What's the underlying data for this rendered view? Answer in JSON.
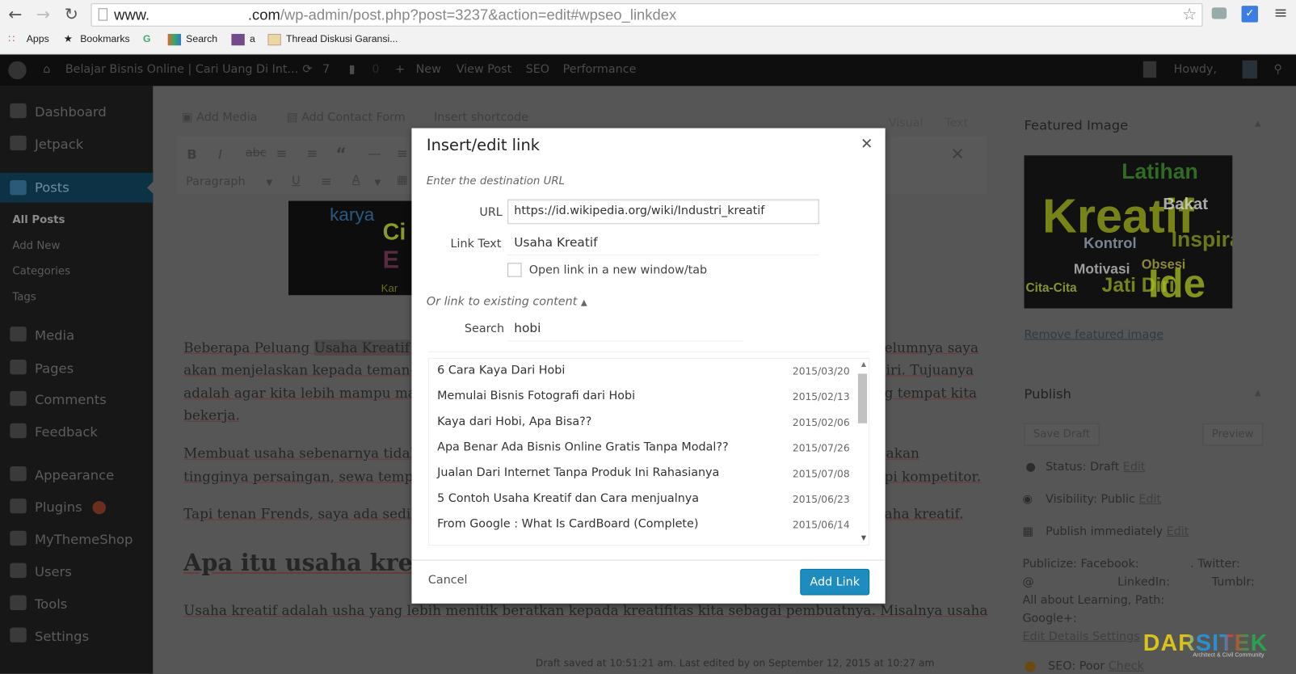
{
  "browser": {
    "url_prefix": "www.",
    "url_domain_suffix": ".com",
    "url_path": "/wp-admin/post.php?post=3237&action=edit#wpseo_linkdex",
    "bookmarks": [
      "Apps",
      "Bookmarks",
      "G",
      "Search",
      "a",
      "Thread Diskusi Garansi..."
    ]
  },
  "admin_bar": {
    "site_name": "Belajar Bisnis Online | Cari Uang Di Int...",
    "updates_count": "7",
    "comments_count": "0",
    "new_label": "New",
    "view_post": "View Post",
    "seo": "SEO",
    "performance": "Performance",
    "howdy": "Howdy,"
  },
  "sidebar": {
    "items": [
      {
        "label": "Dashboard",
        "icon": "dashboard-icon"
      },
      {
        "label": "Jetpack",
        "icon": "jetpack-icon"
      },
      {
        "label": "Posts",
        "icon": "pin-icon",
        "active": true
      },
      {
        "label": "All Posts",
        "sub": true,
        "current": true
      },
      {
        "label": "Add New",
        "sub": true
      },
      {
        "label": "Categories",
        "sub": true
      },
      {
        "label": "Tags",
        "sub": true
      },
      {
        "label": "Media",
        "icon": "media-icon"
      },
      {
        "label": "Pages",
        "icon": "pages-icon"
      },
      {
        "label": "Comments",
        "icon": "comments-icon"
      },
      {
        "label": "Feedback",
        "icon": "feedback-icon"
      },
      {
        "label": "Appearance",
        "icon": "appearance-icon"
      },
      {
        "label": "Plugins",
        "icon": "plugins-icon",
        "badge": true
      },
      {
        "label": "MyThemeShop",
        "icon": "mythemeshop-icon"
      },
      {
        "label": "Users",
        "icon": "users-icon"
      },
      {
        "label": "Tools",
        "icon": "tools-icon"
      },
      {
        "label": "Settings",
        "icon": "settings-icon"
      }
    ]
  },
  "editor": {
    "add_media": "Add Media",
    "add_contact_form": "Add Contact Form",
    "insert_shortcode": "Insert shortcode",
    "tab_visual": "Visual",
    "tab_text": "Text",
    "format_select": "Paragraph",
    "thumb_words": [
      "karya",
      "Ci",
      "E",
      "Kar"
    ],
    "lines": [
      {
        "left_pre": "Beberapa Peluang ",
        "left_hl": "Usaha Kreatif",
        "left_post": " U",
        "right": "elumnya saya"
      },
      {
        "left": "akan menjelaskan kepada teman-",
        "right": "iri. Tujuanya"
      },
      {
        "left": "adalah agar kita lebih mampu ma",
        "right": "g tempat kita"
      },
      {
        "left": "bekerja."
      },
      {
        "left": "Membuat usaha sebenarnya tidak",
        "right": "akan"
      },
      {
        "left": "tingginya persaingan, sewa tempa",
        "right": "pi kompetitor."
      },
      {
        "left": "Tapi tenan Frends, saya ada sedik",
        "right": "aha kreatif."
      }
    ],
    "heading": "Apa itu usaha kreat",
    "last_line": "Usaha kreatif adalah usha yang lebih menitik beratkan kepada kreatifitas kita sebagai pembuatnya. Misalnya usaha",
    "status": "Draft saved at 10:51:21 am. Last edited by      on September 12, 2015 at 10:27 am"
  },
  "featured_image": {
    "title": "Featured Image",
    "words": [
      "Latihan",
      "Kreatif",
      "Bakat",
      "Inspiras",
      "Kontrol",
      "Motivasi",
      "Cita-Cita",
      "Jati Diri",
      "Ide",
      "Obsesi"
    ],
    "remove_link": "Remove featured image"
  },
  "publish": {
    "title": "Publish",
    "save_draft": "Save Draft",
    "preview": "Preview",
    "status": "Status: Draft",
    "visibility": "Visibility: Public",
    "schedule": "Publish immediately",
    "edit": "Edit",
    "publicize_1": "Publicize: Facebook:",
    "publicize_twitter": ". Twitter:",
    "publicize_2a": "@",
    "publicize_linkedin": "LinkedIn:",
    "publicize_tumblr": "Tumblr:",
    "publicize_3": "All about Learning, Path:",
    "publicize_4": "Google+:",
    "edit_details": "Edit Details Settings",
    "seo_label": "SEO: Poor",
    "seo_check": "Check"
  },
  "watermark": {
    "text": "DARSITEK",
    "tagline": "Architect & Civil Community"
  },
  "modal": {
    "title": "Insert/edit link",
    "subtitle": "Enter the destination URL",
    "url_label": "URL",
    "url_value": "https://id.wikipedia.org/wiki/Industri_kreatif",
    "link_text_label": "Link Text",
    "link_text_value": "Usaha Kreatif",
    "new_tab_label": "Open link in a new window/tab",
    "new_tab_checked": false,
    "existing_toggle": "Or link to existing content",
    "search_label": "Search",
    "search_value": "hobi",
    "results": [
      {
        "title": "6 Cara Kaya Dari Hobi",
        "date": "2015/03/20"
      },
      {
        "title": "Memulai Bisnis Fotografi dari Hobi",
        "date": "2015/02/13"
      },
      {
        "title": "Kaya dari Hobi, Apa Bisa??",
        "date": "2015/02/06"
      },
      {
        "title": "Apa Benar Ada Bisnis Online Gratis Tanpa Modal??",
        "date": "2015/07/26"
      },
      {
        "title": "Jualan Dari Internet Tanpa Produk Ini Rahasianya",
        "date": "2015/07/08"
      },
      {
        "title": "5 Contoh Usaha Kreatif dan Cara menjualnya",
        "date": "2015/06/23"
      },
      {
        "title": "From Google : What Is CardBoard (Complete)",
        "date": "2015/06/14"
      }
    ],
    "cancel": "Cancel",
    "add_link": "Add Link",
    "accent": "#1e8cbe"
  }
}
